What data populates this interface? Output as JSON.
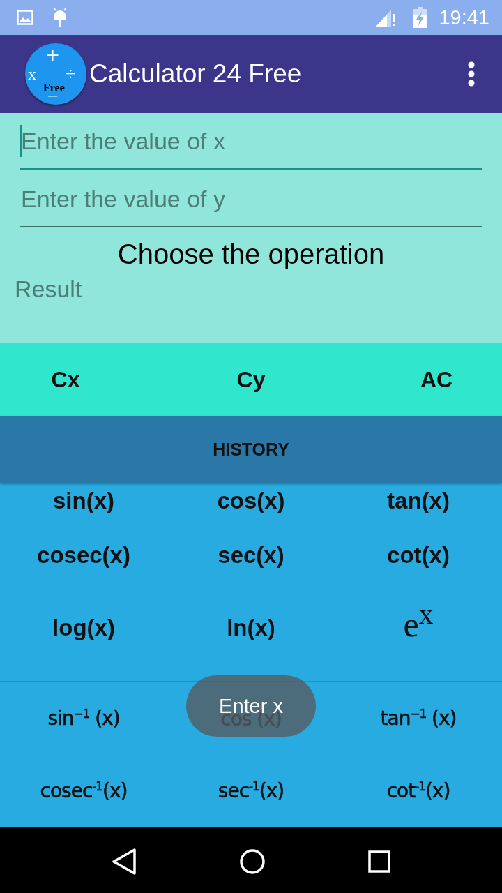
{
  "status_bar": {
    "time": "19:41"
  },
  "app_bar": {
    "title": "Calculator 24 Free",
    "logo": {
      "variable": "x",
      "plus": "+",
      "divide": "÷",
      "minus": "−",
      "badge": "Free"
    }
  },
  "fields": [
    {
      "placeholder": "Enter the value of x",
      "focused": true
    },
    {
      "placeholder": "Enter the value of y",
      "focused": false
    }
  ],
  "prompt": "Choose the operation",
  "result": "Result",
  "clear_buttons": [
    "Cx",
    "Cy",
    "AC"
  ],
  "history_button": "HISTORY",
  "functions": [
    [
      "sin(x)",
      "cos(x)",
      "tan(x)"
    ],
    [
      "cosec(x)",
      "sec(x)",
      "cot(x)"
    ],
    [
      "log(x)",
      "ln(x)",
      {
        "label": "e$^{x}$",
        "kind": "serif"
      }
    ]
  ],
  "inverse_functions": [
    [
      "sin$^{−1}$ (x)",
      "cos (x)",
      "tan$^{−1}$ (x)"
    ],
    [
      "cosec$^{-1}$(x)",
      "sec$^{-1}$(x)",
      "cot$^{-1}$(x)"
    ]
  ],
  "toast": "Enter x"
}
